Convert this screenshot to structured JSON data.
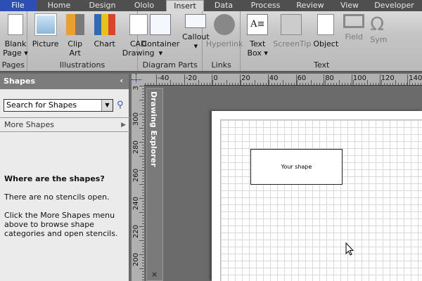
{
  "tabs": [
    "File",
    "Home",
    "Design",
    "Ololo",
    "Insert",
    "Data",
    "Process",
    "Review",
    "View",
    "Developer"
  ],
  "ribbon": {
    "pages": {
      "label": "Pages",
      "blank_page": "Blank Page"
    },
    "illustrations": {
      "label": "Illustrations",
      "picture": "Picture",
      "clip_art": "Clip Art",
      "chart": "Chart",
      "cad": "CAD Drawing"
    },
    "diagram_parts": {
      "label": "Diagram Parts",
      "container": "Container",
      "callout": "Callout"
    },
    "links": {
      "label": "Links",
      "hyperlink": "Hyperlink"
    },
    "text": {
      "label": "Text",
      "text_box": "Text Box",
      "screentip": "ScreenTip",
      "object": "Object",
      "field": "Field",
      "symbol": "Sym"
    }
  },
  "shapes_panel": {
    "title": "Shapes",
    "search_placeholder": "Search for Shapes",
    "more_shapes": "More Shapes",
    "heading": "Where are the shapes?",
    "line1": "There are no stencils open.",
    "line2": "Click the More Shapes menu above to browse shape categories and open stencils."
  },
  "drawing_explorer": "Drawing Explorer",
  "hruler": [
    "-40",
    "-20",
    "0",
    "20",
    "40",
    "60",
    "80",
    "100",
    "120",
    "140"
  ],
  "vruler": [
    "3",
    "300",
    "280",
    "260",
    "240",
    "220",
    "200"
  ],
  "canvas": {
    "shape_text": "Your shape"
  },
  "colors": {
    "file_tab": "#2c4fb5"
  }
}
